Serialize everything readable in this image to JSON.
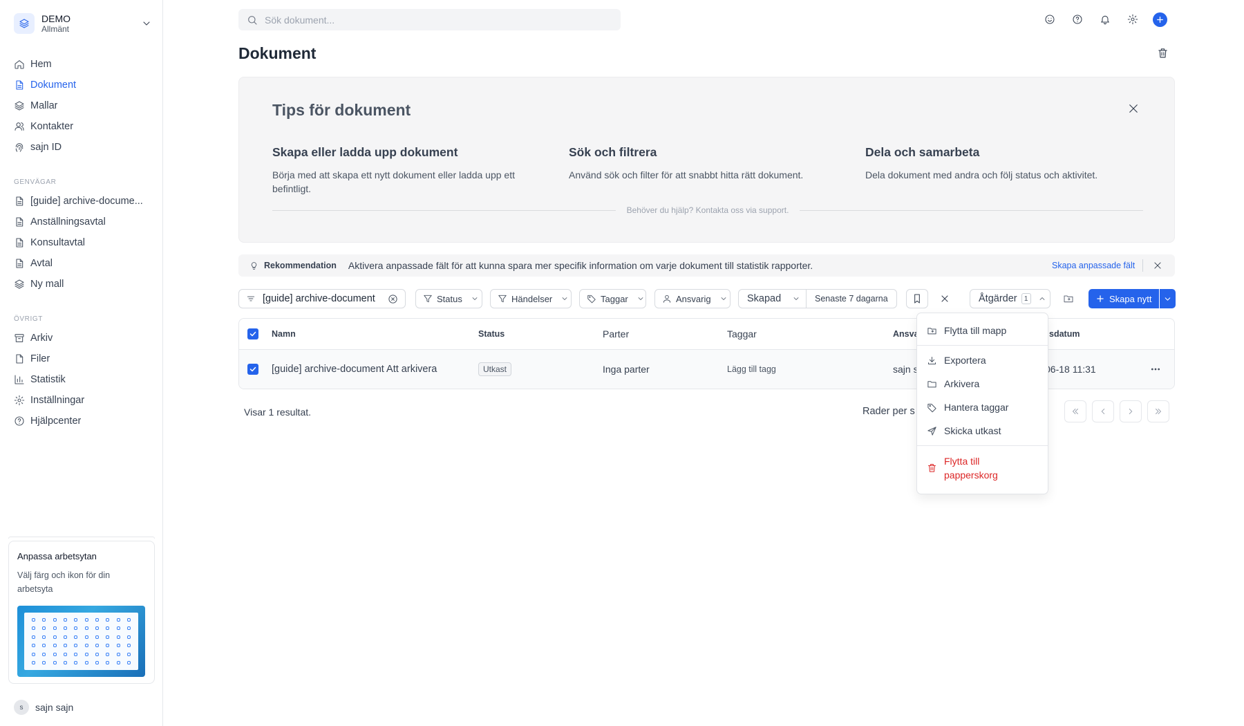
{
  "workspace": {
    "name": "DEMO",
    "subtitle": "Allmänt"
  },
  "nav_main": [
    {
      "label": "Hem",
      "icon": "home-icon"
    },
    {
      "label": "Dokument",
      "icon": "document-icon",
      "active": true
    },
    {
      "label": "Mallar",
      "icon": "layers-icon"
    },
    {
      "label": "Kontakter",
      "icon": "users-icon"
    },
    {
      "label": "sajn ID",
      "icon": "fingerprint-icon"
    }
  ],
  "shortcuts": {
    "label": "GENVÄGAR",
    "items": [
      {
        "label": "[guide] archive-docume..."
      },
      {
        "label": "Anställningsavtal"
      },
      {
        "label": "Konsultavtal"
      },
      {
        "label": "Avtal"
      },
      {
        "label": "Ny mall"
      }
    ]
  },
  "other": {
    "label": "ÖVRIGT",
    "items": [
      {
        "label": "Arkiv"
      },
      {
        "label": "Filer"
      },
      {
        "label": "Statistik"
      },
      {
        "label": "Inställningar"
      },
      {
        "label": "Hjälpcenter"
      }
    ]
  },
  "promo": {
    "title": "Anpassa arbetsytan",
    "text": "Välj färg och ikon för din arbetsyta"
  },
  "user": {
    "initial": "s",
    "name": "sajn sajn"
  },
  "search": {
    "placeholder": "Sök dokument..."
  },
  "page": {
    "title": "Dokument"
  },
  "tips": {
    "title": "Tips för dokument",
    "cards": [
      {
        "heading": "Skapa eller ladda upp dokument",
        "text": "Börja med att skapa ett nytt dokument eller ladda upp ett befintligt."
      },
      {
        "heading": "Sök och filtrera",
        "text": "Använd sök och filter för att snabbt hitta rätt dokument."
      },
      {
        "heading": "Dela och samarbeta",
        "text": "Dela dokument med andra och följ status och aktivitet."
      }
    ],
    "help": "Behöver du hjälp? Kontakta oss via support."
  },
  "recommendation": {
    "label": "Rekommendation",
    "text": "Aktivera anpassade fält för att kunna spara mer specifik information om varje dokument till statistik rapporter.",
    "link": "Skapa anpassade fält"
  },
  "filters": {
    "query": "[guide] archive-document",
    "status": "Status",
    "events": "Händelser",
    "tags": "Taggar",
    "owner": "Ansvarig",
    "created": "Skapad",
    "created_range": "Senaste 7 dagarna",
    "actions": "Åtgärder",
    "actions_count": "1",
    "create": "Skapa nytt"
  },
  "table": {
    "columns": {
      "name": "Namn",
      "status": "Status",
      "parties": "Parter",
      "tags": "Taggar",
      "owner": "Ansva",
      "date": "sdatum"
    },
    "rows": [
      {
        "name": "[guide] archive-document Att arkivera",
        "status": "Utkast",
        "parties": "Inga parter",
        "tags": "Lägg till tagg",
        "owner": "sajn s",
        "date": "06-18 11:31"
      }
    ]
  },
  "footer": {
    "results": "Visar 1 resultat.",
    "rows_per_page": "Rader per s"
  },
  "actions_menu": [
    {
      "label": "Flytta till mapp",
      "icon": "folder-move-icon"
    },
    {
      "label": "Exportera",
      "icon": "download-icon"
    },
    {
      "label": "Arkivera",
      "icon": "folder-icon"
    },
    {
      "label": "Hantera taggar",
      "icon": "tag-icon"
    },
    {
      "label": "Skicka utkast",
      "icon": "send-icon"
    },
    {
      "label": "Flytta till papperskorg",
      "icon": "trash-icon"
    }
  ],
  "colors": {
    "accent": "#2563eb",
    "danger": "#dc2626"
  }
}
